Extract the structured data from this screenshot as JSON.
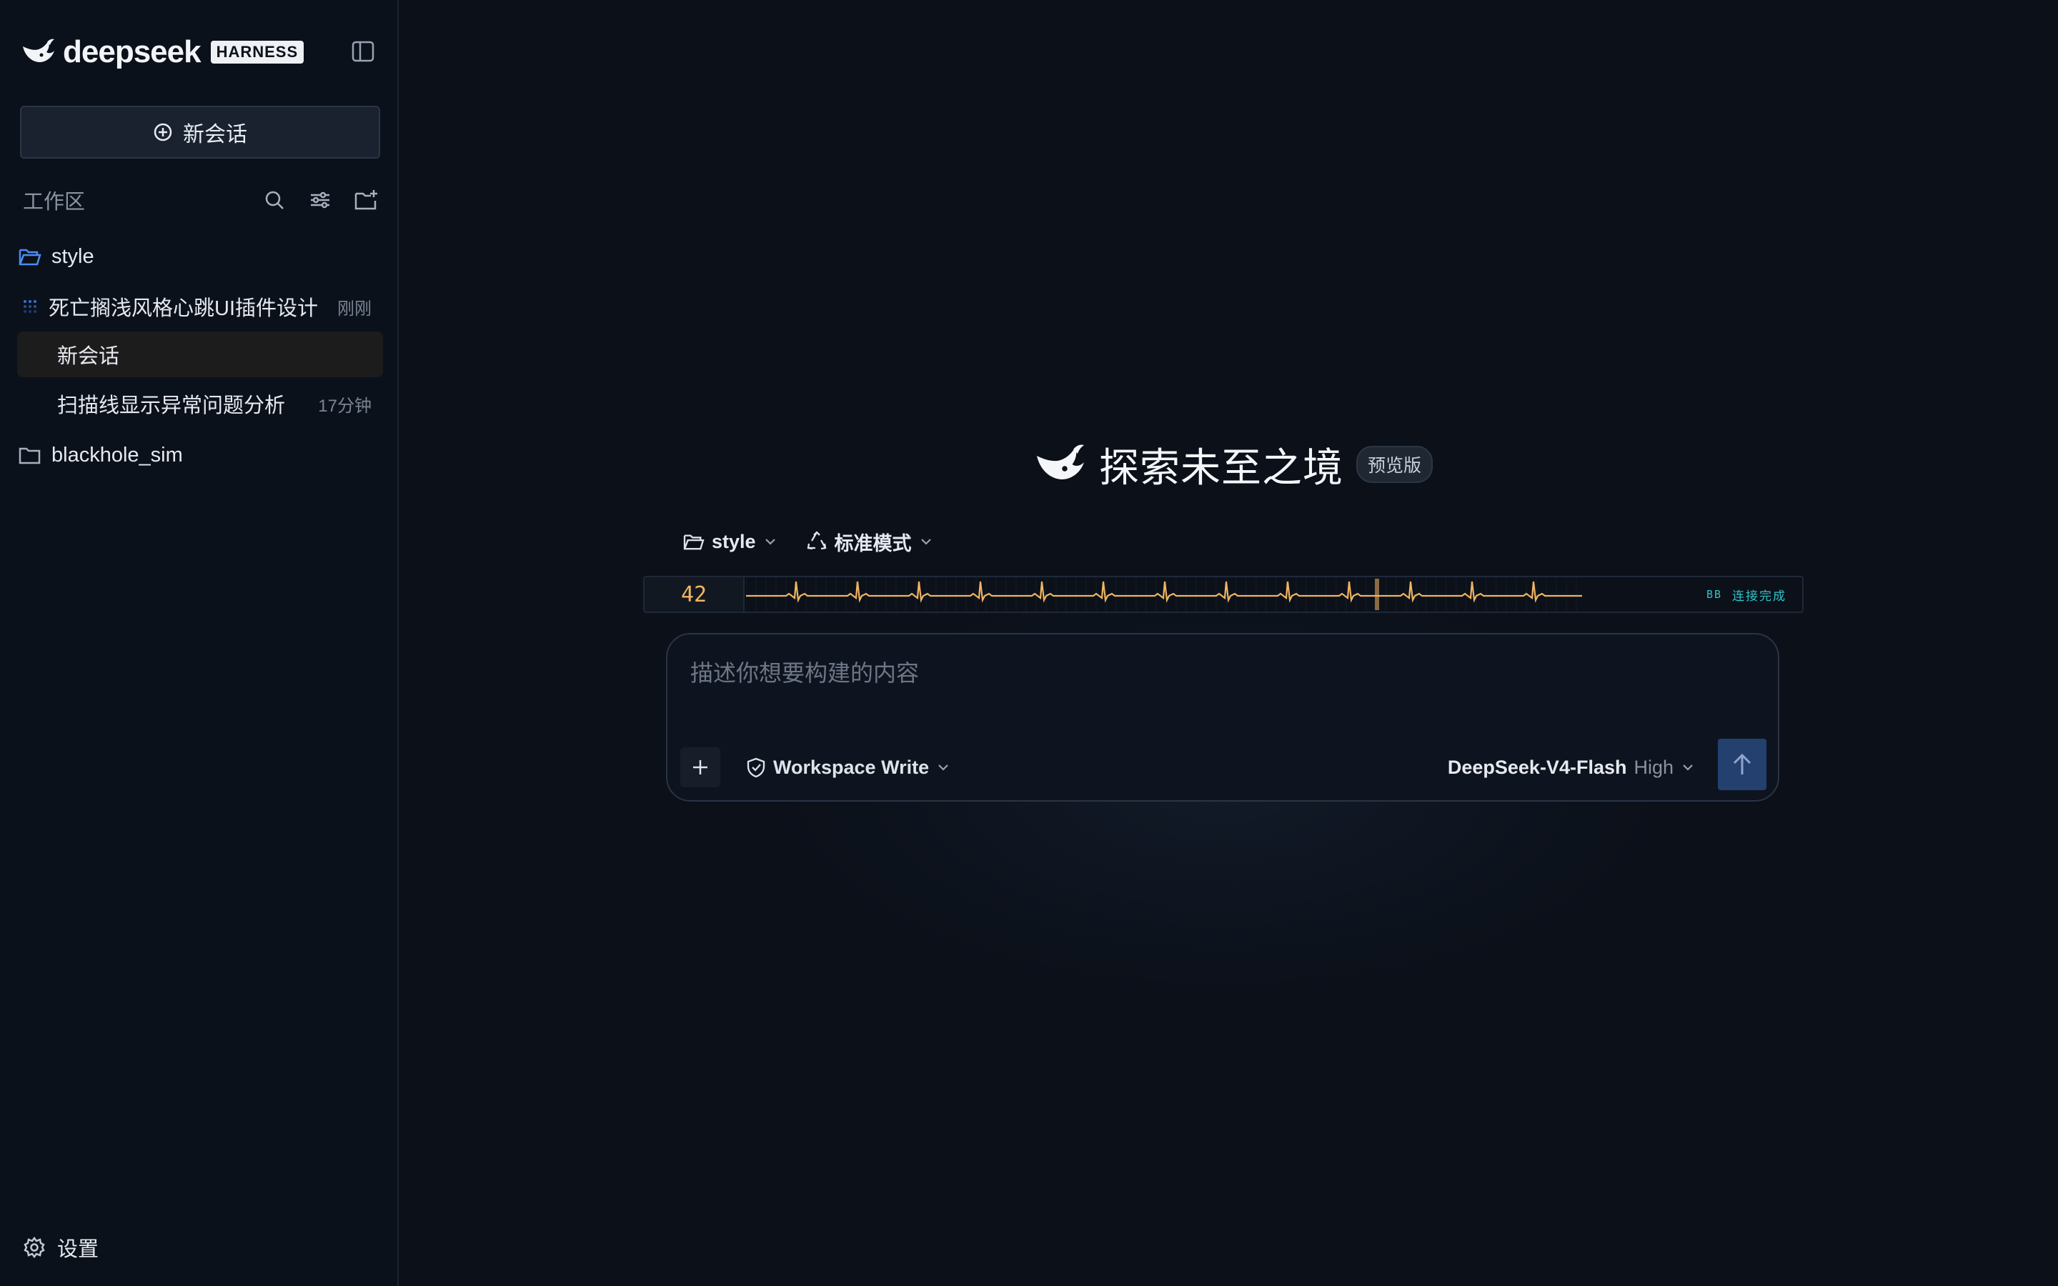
{
  "sidebar": {
    "brand_name": "deepseek",
    "brand_badge": "HARNESS",
    "new_chat_label": "新会话",
    "workspace_label": "工作区",
    "folders": [
      {
        "name": "style",
        "conversations": [
          {
            "title": "死亡搁浅风格心跳UI插件设计",
            "time": "刚刚"
          },
          {
            "title": "新会话",
            "time": ""
          },
          {
            "title": "扫描线显示异常问题分析",
            "time": "17分钟"
          }
        ]
      },
      {
        "name": "blackhole_sim",
        "conversations": []
      }
    ],
    "settings_label": "设置"
  },
  "hero": {
    "title": "探索未至之境",
    "badge": "预览版"
  },
  "selectors": {
    "folder": "style",
    "mode": "标准模式"
  },
  "heartbeat": {
    "bpm": "42",
    "status_code": "BB",
    "status_text": "连接完成"
  },
  "composer": {
    "placeholder": "描述你想要构建的内容",
    "permission": "Workspace Write",
    "model": "DeepSeek-V4-Flash",
    "level": "High"
  },
  "colors": {
    "accent_blue": "#24406f",
    "heartbeat_orange": "#f0b462",
    "status_teal": "#2fc4c8",
    "folder_active_blue": "#4d8df0"
  }
}
